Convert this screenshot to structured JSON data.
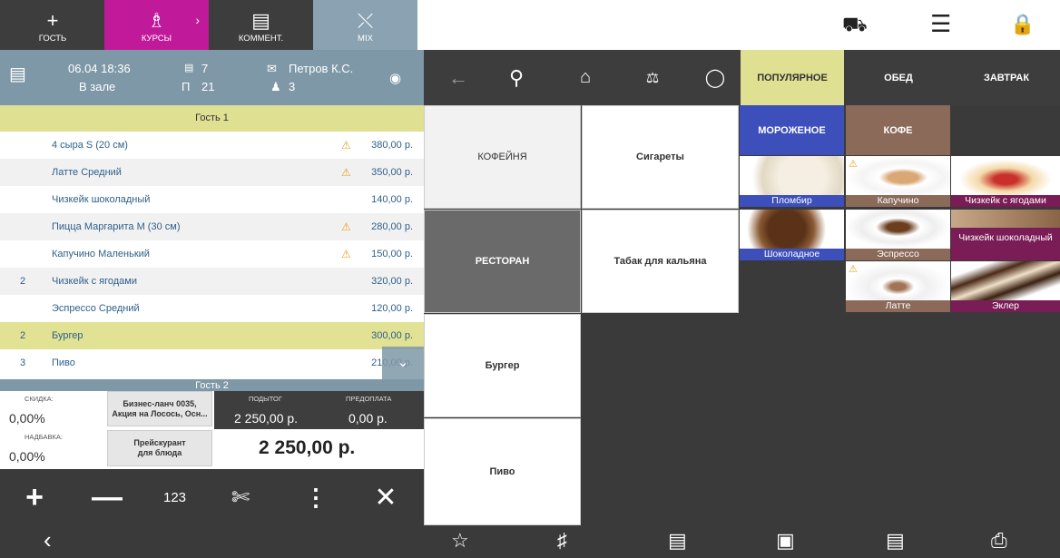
{
  "top_tabs": [
    {
      "label": "ГОСТЬ",
      "icon": "plus-icon"
    },
    {
      "label": "КУРСЫ",
      "icon": "chef-hat-icon"
    },
    {
      "label": "КОММЕНТ.",
      "icon": "comment-icon"
    },
    {
      "label": "MIX",
      "icon": "shuffle-icon"
    }
  ],
  "info": {
    "datetime": "06.04 18:36",
    "location": "В зале",
    "guests_count": "7",
    "table": "21",
    "waiter": "Петров К.С.",
    "persons": "3"
  },
  "order": {
    "guest1": "Гость 1",
    "guest2": "Гость 2",
    "items": [
      {
        "qty": "",
        "name": "4 сыра S (20 см)",
        "warn": true,
        "price": "380,00 р."
      },
      {
        "qty": "",
        "name": "Латте Средний",
        "warn": true,
        "price": "350,00 р."
      },
      {
        "qty": "",
        "name": "Чизкейк шоколадный",
        "warn": false,
        "price": "140,00 р."
      },
      {
        "qty": "",
        "name": "Пицца Маргарита М (30 см)",
        "warn": true,
        "price": "280,00 р."
      },
      {
        "qty": "",
        "name": "Капучино Маленький",
        "warn": true,
        "price": "150,00 р."
      },
      {
        "qty": "2",
        "name": "Чизкейк с ягодами",
        "warn": false,
        "price": "320,00 р."
      },
      {
        "qty": "",
        "name": "Эспрессо Средний",
        "warn": false,
        "price": "120,00 р."
      },
      {
        "qty": "2",
        "name": "Бургер",
        "warn": false,
        "price": "300,00 р."
      },
      {
        "qty": "3",
        "name": "Пиво",
        "warn": false,
        "price": "210,00 р."
      }
    ]
  },
  "totals": {
    "discount_label": "СКИДКА:",
    "discount": "0,00%",
    "markup_label": "НАДБАВКА:",
    "markup": "0,00%",
    "promo_line1": "Бизнес-ланч 0035,",
    "promo_line2": "Акция на Лосось, Осн...",
    "pricelist_line1": "Прейскурант",
    "pricelist_line2": "для блюда",
    "subtotal_label": "ПОДЫТОГ",
    "subtotal": "2 250,00 р.",
    "prepay_label": "ПРЕДОПЛАТА",
    "prepay": "0,00 р.",
    "total": "2 250,00 р."
  },
  "actions": {
    "num": "123"
  },
  "nav_tabs": [
    "ПОПУЛЯРНОЕ",
    "ОБЕД",
    "ЗАВТРАК"
  ],
  "categories": {
    "cafe": "КОФЕЙНЯ",
    "cigs": "Сигареты",
    "restaurant": "РЕСТОРАН",
    "hookah": "Табак для кальяна",
    "burger": "Бургер",
    "beer": "Пиво"
  },
  "subcats": {
    "icecream": "МОРОЖЕНОЕ",
    "coffee": "КОФЕ"
  },
  "products": [
    {
      "name": "Пломбир"
    },
    {
      "name": "Капучино"
    },
    {
      "name": "Чизкейк с ягодами"
    },
    {
      "name": "Шоколадное"
    },
    {
      "name": "Эспрессо"
    },
    {
      "name": "Чизкейк шоколадный"
    },
    {
      "name": "Латте"
    },
    {
      "name": "Эклер"
    }
  ],
  "colors": {
    "accent": "#c0199a",
    "highlight": "#dfe092",
    "blue": "#3d4fba",
    "brown": "#8b6a5a",
    "purple": "#7a1c55"
  }
}
